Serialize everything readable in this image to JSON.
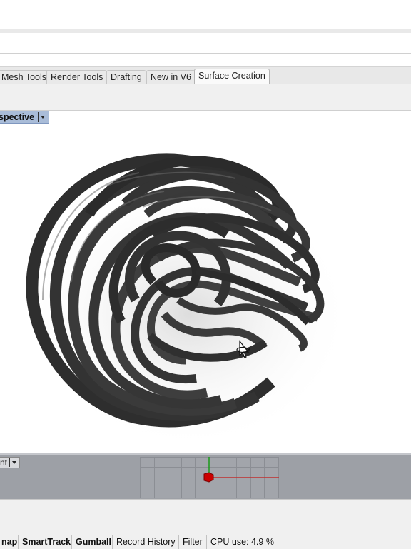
{
  "ribbon": {
    "tabs": [
      {
        "label": "Mesh Tools"
      },
      {
        "label": "Render Tools"
      },
      {
        "label": "Drafting"
      },
      {
        "label": "New in V6"
      },
      {
        "label": "Surface Creation",
        "active": true
      }
    ]
  },
  "viewport": {
    "title": "spective",
    "lower_title": "nt"
  },
  "status_bar": {
    "items": [
      {
        "label": "nap",
        "active": true
      },
      {
        "label": "SmartTrack",
        "active": true
      },
      {
        "label": "Gumball",
        "active": true
      },
      {
        "label": "Record History",
        "active": false
      },
      {
        "label": "Filter",
        "active": false
      }
    ],
    "cpu": "CPU use: 4.9 %"
  },
  "colors": {
    "viewport_title_bg": "#a9bcd8",
    "active_object": "#cc0000",
    "y_axis": "#1a9a1a",
    "x_axis": "#c03030",
    "sculpture": "#3a3a3a"
  },
  "icons": {
    "cursor": "rotate-cursor-icon"
  }
}
